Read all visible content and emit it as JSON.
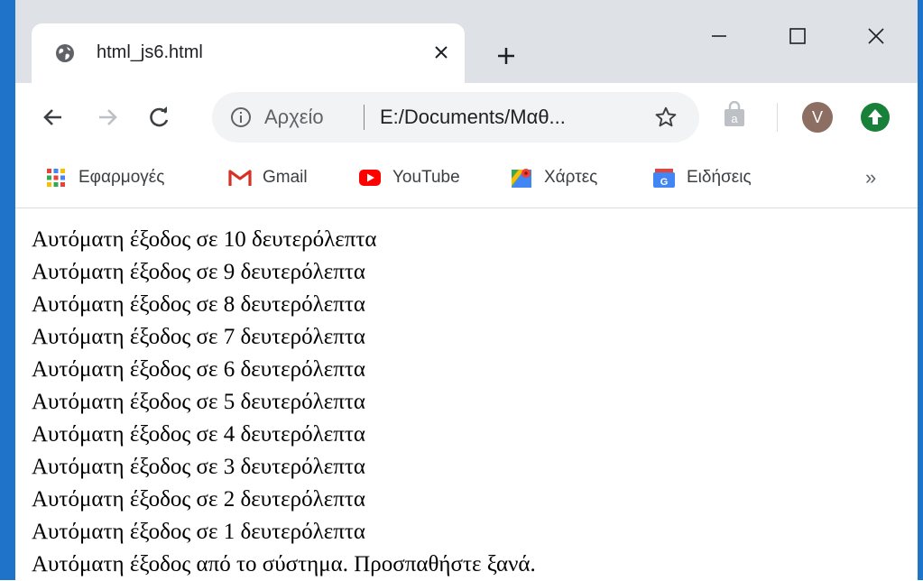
{
  "tab": {
    "title": "html_js6.html",
    "close_glyph": "✕",
    "favicon": "globe-icon"
  },
  "new_tab_glyph": "+",
  "window_controls": {
    "minimize": "—",
    "maximize": "☐",
    "close": "✕"
  },
  "toolbar": {
    "omnibox": {
      "scheme_label": "Αρχείο",
      "url": "E:/Documents/Μαθ..."
    },
    "avatar_letter": "V"
  },
  "bookmarks": [
    {
      "label": "Εφαρμογές",
      "icon": "apps-grid-icon"
    },
    {
      "label": "Gmail",
      "icon": "gmail-icon"
    },
    {
      "label": "YouTube",
      "icon": "youtube-icon"
    },
    {
      "label": "Χάρτες",
      "icon": "maps-icon"
    },
    {
      "label": "Ειδήσεις",
      "icon": "news-icon"
    }
  ],
  "bookmarks_more": "»",
  "content": {
    "lines": [
      "Αυτόματη έξοδος σε 10 δευτερόλεπτα",
      "Αυτόματη έξοδος σε 9 δευτερόλεπτα",
      "Αυτόματη έξοδος σε 8 δευτερόλεπτα",
      "Αυτόματη έξοδος σε 7 δευτερόλεπτα",
      "Αυτόματη έξοδος σε 6 δευτερόλεπτα",
      "Αυτόματη έξοδος σε 5 δευτερόλεπτα",
      "Αυτόματη έξοδος σε 4 δευτερόλεπτα",
      "Αυτόματη έξοδος σε 3 δευτερόλεπτα",
      "Αυτόματη έξοδος σε 2 δευτερόλεπτα",
      "Αυτόματη έξοδος σε 1 δευτερόλεπτα",
      "Αυτόματη έξοδος από το σύστημα. Προσπαθήστε ξανά."
    ]
  },
  "colors": {
    "frame_blue": "#1f74c9",
    "tabstrip": "#dee1e6",
    "avatar": "#8d6e63",
    "update_green": "#188038"
  }
}
